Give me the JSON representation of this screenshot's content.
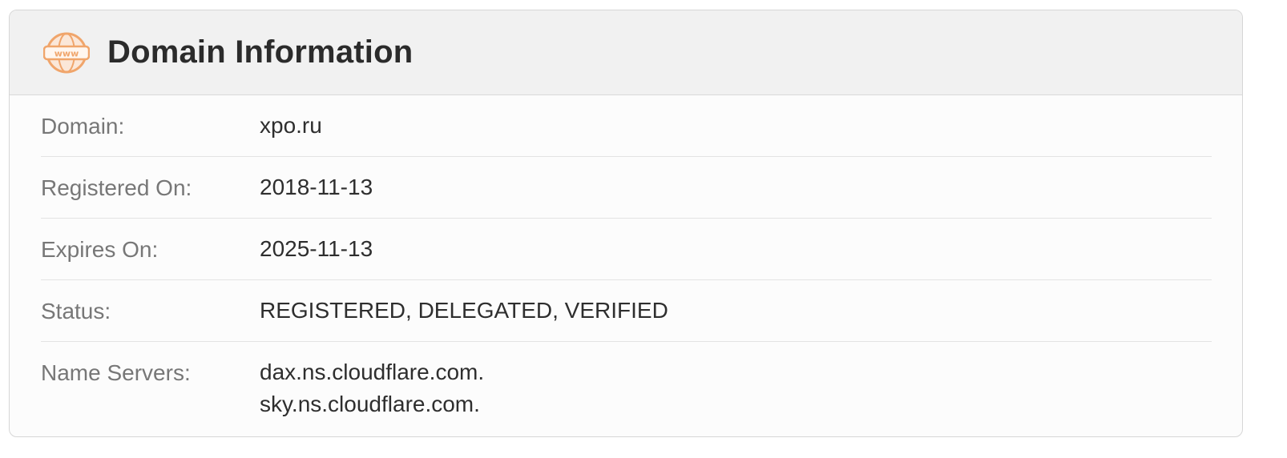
{
  "panel": {
    "title": "Domain Information",
    "icon": "www-globe-icon",
    "accent_color": "#f0a56b"
  },
  "rows": [
    {
      "label": "Domain:",
      "value": "xpo.ru"
    },
    {
      "label": "Registered On:",
      "value": "2018-11-13"
    },
    {
      "label": "Expires On:",
      "value": "2025-11-13"
    },
    {
      "label": "Status:",
      "value": "REGISTERED, DELEGATED, VERIFIED"
    },
    {
      "label": "Name Servers:",
      "values": [
        "dax.ns.cloudflare.com.",
        "sky.ns.cloudflare.com."
      ]
    }
  ]
}
